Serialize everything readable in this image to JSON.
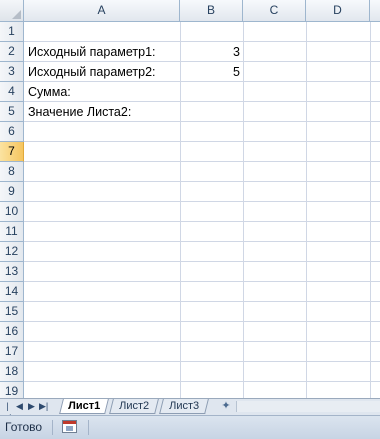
{
  "spreadsheet": {
    "columns": [
      "A",
      "B",
      "C",
      "D"
    ],
    "rows": [
      "1",
      "2",
      "3",
      "4",
      "5",
      "6",
      "7",
      "8",
      "9",
      "10",
      "11",
      "12",
      "13",
      "14",
      "15",
      "16",
      "17",
      "18",
      "19"
    ],
    "selected_row": "7",
    "cells": {
      "A2": "Исходный параметр1:",
      "B2": "3",
      "A3": "Исходный параметр2:",
      "B3": "5",
      "A4": "Сумма:",
      "A5": "Значение Листа2:"
    }
  },
  "sheet_tabs": {
    "tabs": [
      "Лист1",
      "Лист2",
      "Лист3"
    ],
    "active": "Лист1"
  },
  "status_bar": {
    "status": "Готово"
  },
  "colors": {
    "selected_row_header": "#f6c55f",
    "header_border": "#9eb6ce",
    "gridline": "#d0d7e5"
  }
}
